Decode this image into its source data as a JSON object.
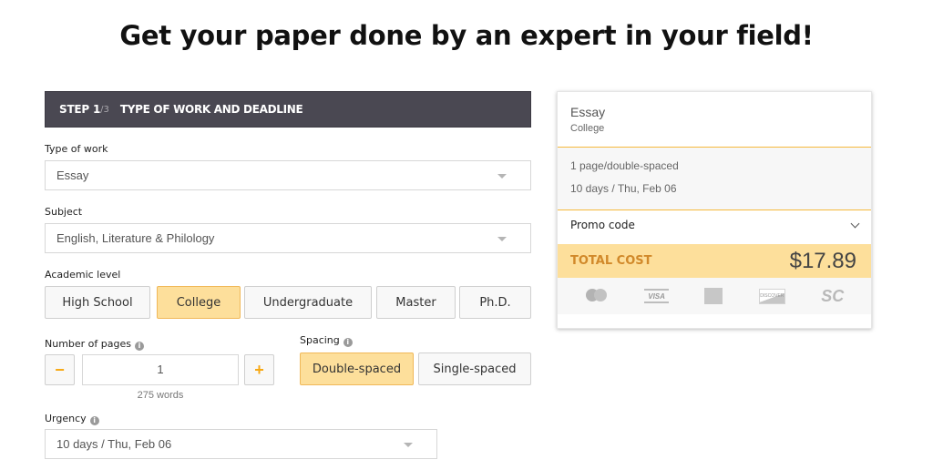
{
  "headline": "Get your paper done by an expert in your field!",
  "step": {
    "number": "STEP 1",
    "of": "/3",
    "title": "TYPE OF WORK AND DEADLINE"
  },
  "form": {
    "type_of_work": {
      "label": "Type of work",
      "value": "Essay"
    },
    "subject": {
      "label": "Subject",
      "value": "English, Literature & Philology"
    },
    "academic_level": {
      "label": "Academic level",
      "options": [
        "High School",
        "College",
        "Undergraduate",
        "Master",
        "Ph.D."
      ],
      "selected": "College"
    },
    "pages": {
      "label": "Number of pages",
      "value": "1",
      "words": "275 words",
      "minus": "−",
      "plus": "+"
    },
    "spacing": {
      "label": "Spacing",
      "options": [
        "Double-spaced",
        "Single-spaced"
      ],
      "selected": "Double-spaced"
    },
    "urgency": {
      "label": "Urgency",
      "value": "10 days / Thu, Feb 06"
    },
    "info_icon": "i"
  },
  "summary": {
    "type": "Essay",
    "level": "College",
    "pages_spacing": "1 page/double-spaced",
    "deadline": "10 days / Thu, Feb 06",
    "promo_label": "Promo code",
    "total_label": "TOTAL COST",
    "total_value": "$17.89",
    "payment_methods": [
      "mastercard-icon",
      "visa-icon",
      "amex-icon",
      "discover-icon",
      "sc-icon"
    ],
    "visa_text": "VISA",
    "discover_text": "DISCOVER",
    "sc_text": "SC"
  },
  "colors": {
    "accent": "#fddf9b",
    "accent_border": "#f0b858",
    "step_bar": "#4a4852",
    "total_label": "#d1892a",
    "stepper_icon": "#f7a813"
  }
}
